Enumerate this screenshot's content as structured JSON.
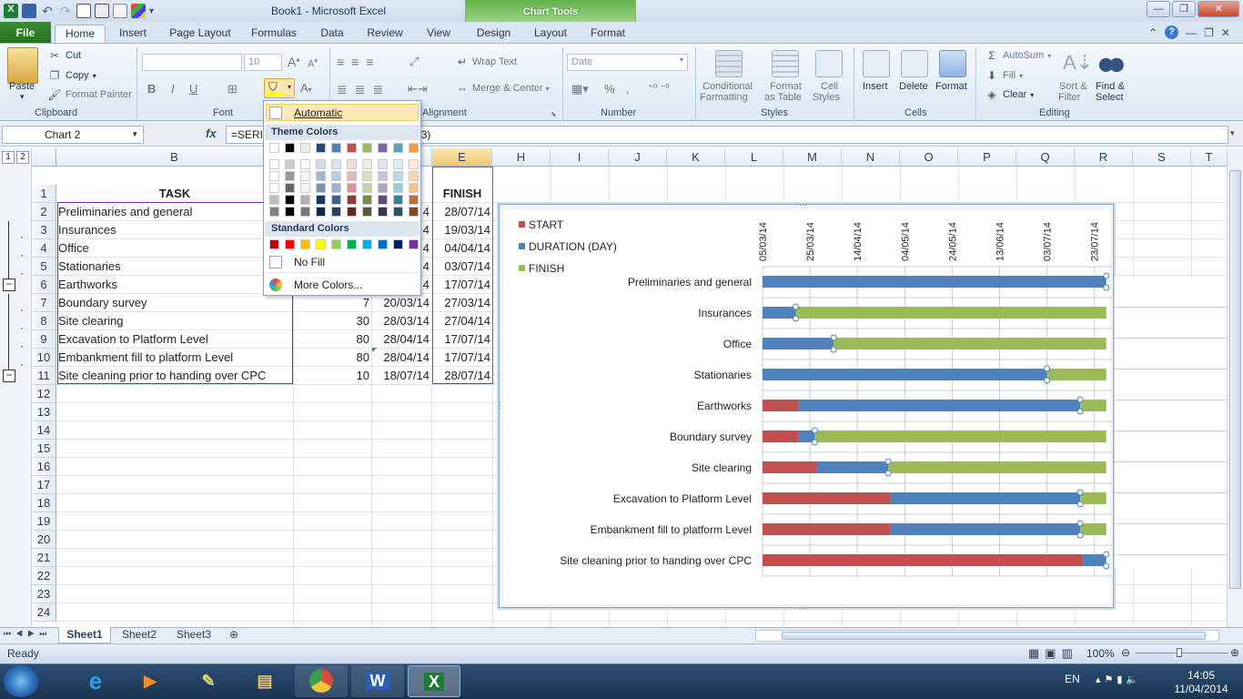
{
  "window": {
    "doc_title": "Book1  -  Microsoft Excel",
    "context_tab": "Chart Tools",
    "buttons": {
      "minimize": "—",
      "restore": "❐",
      "close": "✕"
    }
  },
  "tabs": [
    "Home",
    "Insert",
    "Page Layout",
    "Formulas",
    "Data",
    "Review",
    "View",
    "Design",
    "Layout",
    "Format"
  ],
  "file_tab": "File",
  "ribbon": {
    "clipboard": {
      "paste": "Paste",
      "cut": "Cut",
      "copy": "Copy",
      "format_painter": "Format Painter",
      "label": "Clipboard"
    },
    "font": {
      "size": "10",
      "label": "Font",
      "bold": "B",
      "italic": "I",
      "underline": "U"
    },
    "alignment": {
      "wrap": "Wrap Text",
      "merge": "Merge & Center",
      "label": "Alignment"
    },
    "number": {
      "format": "Date",
      "label": "Number",
      "pct": "%"
    },
    "styles": {
      "cond": "Conditional",
      "cond2": "Formatting",
      "table": "Format",
      "table2": "as Table",
      "cell": "Cell",
      "cell2": "Styles",
      "label": "Styles"
    },
    "cells": {
      "insert": "Insert",
      "delete": "Delete",
      "format": "Format",
      "label": "Cells"
    },
    "editing": {
      "autosum": "AutoSum",
      "fill": "Fill",
      "clear": "Clear",
      "sort": "Sort &",
      "sort2": "Filter",
      "find": "Find &",
      "find2": "Select",
      "label": "Editing"
    }
  },
  "formula_bar": {
    "name_box": "Chart 2",
    "fx": "fx",
    "formula": "=SERIES(                                                    :$B$11,Sheet1!$E$2:$E$11,3)"
  },
  "columns": [
    "B",
    "E",
    "H",
    "I",
    "J",
    "K",
    "L",
    "M",
    "N",
    "O",
    "P",
    "Q",
    "R",
    "S",
    "T"
  ],
  "rows": [
    "1",
    "2",
    "3",
    "4",
    "5",
    "6",
    "7",
    "8",
    "9",
    "10",
    "11",
    "12",
    "13",
    "14",
    "15",
    "16",
    "17",
    "18",
    "19",
    "20",
    "21",
    "22",
    "23",
    "24"
  ],
  "outline_levels": [
    "1",
    "2"
  ],
  "sheet": {
    "header_task": "TASK",
    "header_finish": "FINISH",
    "tasks": [
      "Preliminaries and general",
      "Insurances",
      "Office",
      "Stationaries",
      "Earthworks",
      "Boundary survey",
      "Site clearing",
      "Excavation to Platform Level",
      "Embankment fill to platform Level",
      "Site cleaning prior to handing over CPC"
    ],
    "col_c_partial": [
      "4",
      "4",
      "4",
      "4",
      "4"
    ],
    "duration": [
      "",
      "",
      "",
      "",
      "",
      "7",
      "30",
      "80",
      "80",
      "10"
    ],
    "start": [
      "",
      "",
      "",
      "",
      "",
      "20/03/14",
      "28/03/14",
      "28/04/14",
      "28/04/14",
      "18/07/14"
    ],
    "finish": [
      "28/07/14",
      "19/03/14",
      "04/04/14",
      "03/07/14",
      "17/07/14",
      "27/03/14",
      "27/04/14",
      "17/07/14",
      "17/07/14",
      "28/07/14"
    ]
  },
  "color_menu": {
    "automatic": "Automatic",
    "theme_header": "Theme Colors",
    "standard_header": "Standard Colors",
    "no_fill": "No Fill",
    "more": "More Colors...",
    "theme_top": [
      "#ffffff",
      "#000000",
      "#eeece1",
      "#1f497d",
      "#4f81bd",
      "#c0504d",
      "#9bbb59",
      "#8064a2",
      "#4bacc6",
      "#f79646"
    ],
    "standard": [
      "#c00000",
      "#ff0000",
      "#ffc000",
      "#ffff00",
      "#92d050",
      "#00b050",
      "#00b0f0",
      "#0070c0",
      "#002060",
      "#7030a0"
    ]
  },
  "chart_data": {
    "type": "bar",
    "stacked": true,
    "orientation": "horizontal",
    "legend_position": "top-left",
    "series": [
      {
        "name": "START",
        "color": "#c0504d"
      },
      {
        "name": "DURATION (DAY)",
        "color": "#4f81bd"
      },
      {
        "name": "FINISH",
        "color": "#9bbb59"
      }
    ],
    "categories": [
      "Preliminaries and general",
      "Insurances",
      "Office",
      "Stationaries",
      "Earthworks",
      "Boundary survey",
      "Site clearing",
      "Excavation to Platform Level",
      "Embankment fill to platform Level",
      "Site cleaning prior to handing over CPC"
    ],
    "x_ticks": [
      "05/03/14",
      "25/03/14",
      "14/04/14",
      "04/05/14",
      "24/05/14",
      "13/06/14",
      "03/07/14",
      "23/07/14"
    ],
    "x_range": [
      "05/03/14",
      "23/07/14"
    ],
    "bars": [
      {
        "start": "05/03/14",
        "duration_end": "28/07/14",
        "finish_end": "28/07/14"
      },
      {
        "start": "05/03/14",
        "duration_end": "19/03/14",
        "finish_end": "28/07/14"
      },
      {
        "start": "05/03/14",
        "duration_end": "04/04/14",
        "finish_end": "28/07/14"
      },
      {
        "start": "05/03/14",
        "duration_end": "03/07/14",
        "finish_end": "28/07/14"
      },
      {
        "start": "20/03/14",
        "duration_end": "17/07/14",
        "finish_end": "28/07/14"
      },
      {
        "start": "20/03/14",
        "duration_end": "27/03/14",
        "finish_end": "28/07/14"
      },
      {
        "start": "28/03/14",
        "duration_end": "27/04/14",
        "finish_end": "28/07/14"
      },
      {
        "start": "28/04/14",
        "duration_end": "17/07/14",
        "finish_end": "28/07/14"
      },
      {
        "start": "28/04/14",
        "duration_end": "17/07/14",
        "finish_end": "28/07/14"
      },
      {
        "start": "18/07/14",
        "duration_end": "28/07/14",
        "finish_end": "28/07/14"
      }
    ]
  },
  "sheet_tabs": [
    "Sheet1",
    "Sheet2",
    "Sheet3"
  ],
  "status": {
    "ready": "Ready",
    "zoom": "100%"
  },
  "taskbar": {
    "lang": "EN",
    "time": "14:05",
    "date": "11/04/2014"
  }
}
